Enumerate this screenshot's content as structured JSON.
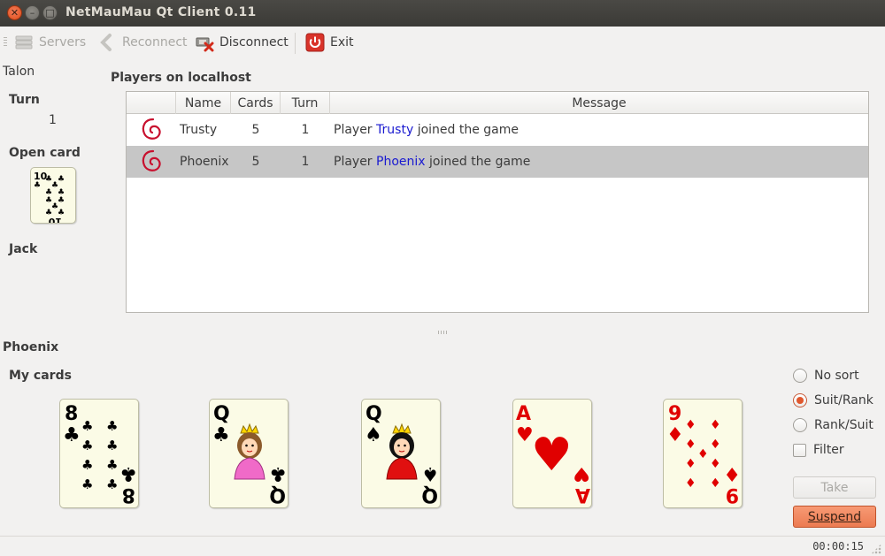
{
  "window": {
    "title": "NetMauMau Qt Client 0.11"
  },
  "toolbar": {
    "servers_label": "Servers",
    "reconnect_label": "Reconnect",
    "disconnect_label": "Disconnect",
    "exit_label": "Exit"
  },
  "left": {
    "talon_label": "Talon",
    "turn_label": "Turn",
    "turn_value": "1",
    "open_card_label": "Open card",
    "open_card": {
      "rank": "10",
      "suit": "clubs"
    },
    "jack_label": "Jack"
  },
  "players": {
    "title": "Players on localhost",
    "columns": [
      "",
      "Name",
      "Cards",
      "Turn",
      "Message"
    ],
    "rows": [
      {
        "name": "Trusty",
        "cards": "5",
        "turn": "1",
        "msg_prefix": "Player",
        "msg_name": "Trusty",
        "msg_suffix": "joined the game",
        "selected": false
      },
      {
        "name": "Phoenix",
        "cards": "5",
        "turn": "1",
        "msg_prefix": "Player",
        "msg_name": "Phoenix",
        "msg_suffix": "joined the game",
        "selected": true
      }
    ]
  },
  "hand": {
    "player_name": "Phoenix",
    "my_cards_label": "My cards",
    "cards": [
      {
        "rank": "8",
        "suit": "clubs"
      },
      {
        "rank": "Q",
        "suit": "clubs"
      },
      {
        "rank": "Q",
        "suit": "spades"
      },
      {
        "rank": "A",
        "suit": "hearts"
      },
      {
        "rank": "9",
        "suit": "diamonds"
      }
    ]
  },
  "sorting": {
    "no_sort": "No sort",
    "suit_rank": "Suit/Rank",
    "rank_suit": "Rank/Suit",
    "filter": "Filter",
    "selected": "suit_rank"
  },
  "actions": {
    "take_label": "Take",
    "suspend_label": "Suspend"
  },
  "status": {
    "clock": "00:00:15"
  },
  "colors": {
    "accent": "#e0572d",
    "selection": "#c6c6c6",
    "player_link": "#1a1ad0",
    "card_red": "#e00000",
    "card_black": "#000000"
  }
}
